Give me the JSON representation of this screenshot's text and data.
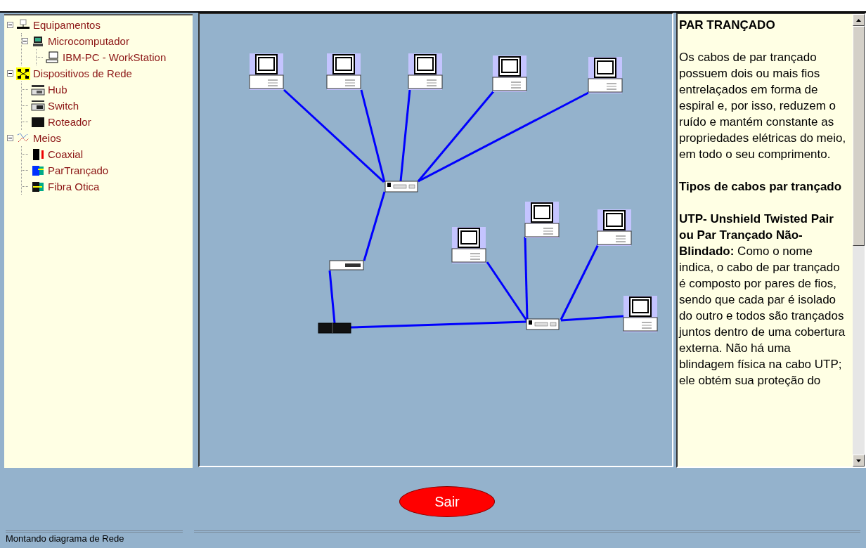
{
  "tree": [
    {
      "label": "Equipamentos",
      "kind": "network",
      "expanded": true,
      "children": [
        {
          "label": "Microcomputador",
          "kind": "computer",
          "expanded": true,
          "children": [
            {
              "label": "IBM-PC - WorkStation",
              "kind": "workstation"
            }
          ]
        }
      ]
    },
    {
      "label": "Dispositivos de Rede",
      "kind": "devices",
      "expanded": true,
      "children": [
        {
          "label": "Hub",
          "kind": "hub"
        },
        {
          "label": "Switch",
          "kind": "switch"
        },
        {
          "label": "Roteador",
          "kind": "router"
        }
      ]
    },
    {
      "label": "Meios",
      "kind": "media",
      "expanded": true,
      "children": [
        {
          "label": "Coaxial",
          "kind": "coax"
        },
        {
          "label": "ParTrançado",
          "kind": "twisted"
        },
        {
          "label": "Fibra Otica",
          "kind": "fiber"
        }
      ]
    }
  ],
  "diagram": {
    "nodes": [
      {
        "kind": "pc"
      },
      {
        "kind": "pc"
      },
      {
        "kind": "pc"
      },
      {
        "kind": "pc"
      },
      {
        "kind": "pc"
      },
      {
        "kind": "pc"
      },
      {
        "kind": "pc"
      },
      {
        "kind": "pc"
      },
      {
        "kind": "pc"
      },
      {
        "kind": "hub"
      },
      {
        "kind": "switch"
      },
      {
        "kind": "router"
      },
      {
        "kind": "hub"
      }
    ]
  },
  "info": [
    {
      "kind": "heading",
      "text": "PAR TRANÇADO"
    },
    {
      "kind": "paragraph",
      "text": "Os cabos de par trançado possuem dois ou mais fios entrelaçados em forma de espiral e, por isso, reduzem o ruído e mantém constante as propriedades elétricas do meio, em todo o seu comprimento."
    },
    {
      "kind": "heading",
      "text": "Tipos de cabos par trançado"
    },
    {
      "kind": "paragraph",
      "text": "**UTP- Unshield Twisted Pair ou Par Trançado Não-Blindado:** Como o nome indica, o cabo de par trançado é composto por pares de fios, sendo que cada par é isolado do outro e todos são trançados juntos dentro de uma cobertura externa. Não há uma blindagem física na cabo UTP; ele obtém sua proteção do"
    }
  ],
  "exit_button": "Sair",
  "status_bar": "Montando diagrama de Rede"
}
